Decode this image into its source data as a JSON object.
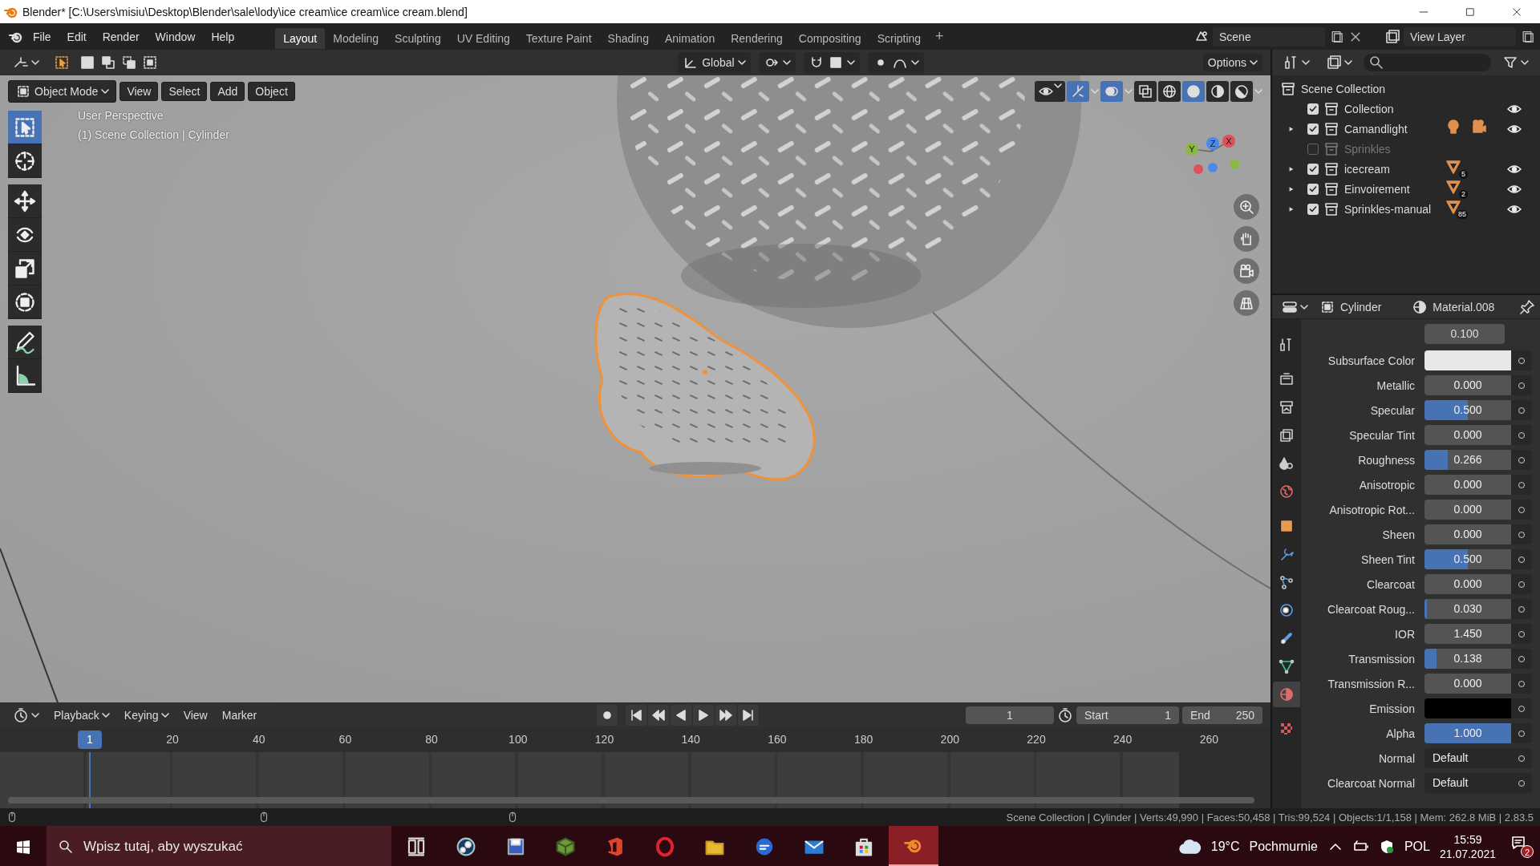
{
  "window": {
    "title": "Blender* [C:\\Users\\misiu\\Desktop\\Blender\\sale\\lody\\ice cream\\ice cream\\ice cream.blend]"
  },
  "menu": [
    "File",
    "Edit",
    "Render",
    "Window",
    "Help"
  ],
  "workspaces": [
    {
      "label": "Layout",
      "selected": true
    },
    {
      "label": "Modeling",
      "selected": false
    },
    {
      "label": "Sculpting",
      "selected": false
    },
    {
      "label": "UV Editing",
      "selected": false
    },
    {
      "label": "Texture Paint",
      "selected": false
    },
    {
      "label": "Shading",
      "selected": false
    },
    {
      "label": "Animation",
      "selected": false
    },
    {
      "label": "Rendering",
      "selected": false
    },
    {
      "label": "Compositing",
      "selected": false
    },
    {
      "label": "Scripting",
      "selected": false
    }
  ],
  "add_workspace": "+",
  "scene": "Scene",
  "view_layer": "View Layer",
  "viewport": {
    "orientation": "Global",
    "options": "Options",
    "mode": "Object Mode",
    "menus": [
      "View",
      "Select",
      "Add",
      "Object"
    ],
    "overlay_lines": [
      "User Perspective",
      "(1) Scene Collection | Cylinder"
    ],
    "gizmo_axes": [
      "Y",
      "Z",
      "X"
    ],
    "tools": [
      {
        "kind": "select",
        "selected": true
      },
      {
        "kind": "cursor",
        "selected": false
      },
      {
        "kind": "move",
        "selected": false
      },
      {
        "kind": "rotate",
        "selected": false
      },
      {
        "kind": "scale",
        "selected": false
      },
      {
        "kind": "transform",
        "selected": false
      },
      {
        "kind": "annotate",
        "selected": false
      },
      {
        "kind": "measure",
        "selected": false
      }
    ]
  },
  "outliner": {
    "root": "Scene Collection",
    "items": [
      {
        "label": "Collection",
        "expander": false,
        "checked": true,
        "disabled": false,
        "eye": true
      },
      {
        "label": "Camandlight",
        "expander": true,
        "checked": true,
        "disabled": false,
        "eye": true,
        "badges": [
          {
            "kind": "light"
          },
          {
            "kind": "camera"
          }
        ]
      },
      {
        "label": "Sprinkles",
        "expander": false,
        "checked": false,
        "disabled": true,
        "eye": false
      },
      {
        "label": "icecream",
        "expander": true,
        "checked": true,
        "disabled": false,
        "eye": true,
        "badges": [
          {
            "kind": "mesh",
            "count": "5"
          }
        ]
      },
      {
        "label": "Einvoirement",
        "expander": true,
        "checked": true,
        "disabled": false,
        "eye": true,
        "badges": [
          {
            "kind": "mesh",
            "count": "2"
          }
        ]
      },
      {
        "label": "Sprinkles-manual",
        "expander": true,
        "checked": true,
        "disabled": false,
        "eye": true,
        "badges": [
          {
            "kind": "mesh",
            "count": "85"
          }
        ]
      }
    ]
  },
  "properties": {
    "object": "Cylinder",
    "material": "Material.008",
    "top_value": "0.100",
    "tabs": [
      {
        "kind": "tool",
        "selected": false
      },
      {
        "kind": "render",
        "selected": false
      },
      {
        "kind": "output",
        "selected": false
      },
      {
        "kind": "viewlayer",
        "selected": false
      },
      {
        "kind": "scene",
        "selected": false
      },
      {
        "kind": "world",
        "selected": false
      },
      {
        "kind": "object",
        "selected": false
      },
      {
        "kind": "modifier",
        "selected": false
      },
      {
        "kind": "particles",
        "selected": false
      },
      {
        "kind": "physics",
        "selected": false
      },
      {
        "kind": "constraint",
        "selected": false
      },
      {
        "kind": "data",
        "selected": false
      },
      {
        "kind": "material",
        "selected": true
      },
      {
        "kind": "texture",
        "selected": false
      }
    ],
    "rows": [
      {
        "label": "Subsurface Color",
        "kind": "color",
        "color": "#e8e8e8"
      },
      {
        "label": "Metallic",
        "kind": "slider",
        "value": "0.000",
        "level": 0
      },
      {
        "label": "Specular",
        "kind": "slider",
        "value": "0.500",
        "level": 0.5
      },
      {
        "label": "Specular Tint",
        "kind": "slider",
        "value": "0.000",
        "level": 0
      },
      {
        "label": "Roughness",
        "kind": "slider",
        "value": "0.266",
        "level": 0.266
      },
      {
        "label": "Anisotropic",
        "kind": "slider",
        "value": "0.000",
        "level": 0
      },
      {
        "label": "Anisotropic Rot...",
        "kind": "slider",
        "value": "0.000",
        "level": 0
      },
      {
        "label": "Sheen",
        "kind": "slider",
        "value": "0.000",
        "level": 0
      },
      {
        "label": "Sheen Tint",
        "kind": "slider",
        "value": "0.500",
        "level": 0.5
      },
      {
        "label": "Clearcoat",
        "kind": "slider",
        "value": "0.000",
        "level": 0
      },
      {
        "label": "Clearcoat Roug...",
        "kind": "slider",
        "value": "0.030",
        "level": 0.03
      },
      {
        "label": "IOR",
        "kind": "number",
        "value": "1.450"
      },
      {
        "label": "Transmission",
        "kind": "slider",
        "value": "0.138",
        "level": 0.138
      },
      {
        "label": "Transmission R...",
        "kind": "slider",
        "value": "0.000",
        "level": 0
      },
      {
        "label": "Emission",
        "kind": "color",
        "color": "#000000"
      },
      {
        "label": "Alpha",
        "kind": "slider",
        "value": "1.000",
        "level": 1
      },
      {
        "label": "Normal",
        "kind": "menu",
        "value": "Default"
      },
      {
        "label": "Clearcoat Normal",
        "kind": "menu",
        "value": "Default"
      }
    ]
  },
  "timeline": {
    "menus": [
      "Playback",
      "Keying",
      "View",
      "Marker"
    ],
    "current_frame": "1",
    "start_label": "Start",
    "start": "1",
    "end_label": "End",
    "end": "250",
    "marker": "1",
    "ticks": [
      "20",
      "40",
      "60",
      "80",
      "100",
      "120",
      "140",
      "160",
      "180",
      "200",
      "220",
      "240",
      "260"
    ]
  },
  "status_bar": {
    "text": "Scene Collection | Cylinder | Verts:49,990 | Faces:50,458 | Tris:99,524 | Objects:1/1,158 | Mem: 262.8 MiB | 2.83.5"
  },
  "taskbar": {
    "search_placeholder": "Wpisz tutaj, aby wyszukać",
    "apps": [
      {
        "kind": "taskview",
        "selected": false
      },
      {
        "kind": "steam",
        "selected": false
      },
      {
        "kind": "save",
        "selected": false
      },
      {
        "kind": "block",
        "selected": false
      },
      {
        "kind": "office",
        "selected": false
      },
      {
        "kind": "opera",
        "selected": false
      },
      {
        "kind": "folder",
        "selected": false
      },
      {
        "kind": "chat",
        "selected": false
      },
      {
        "kind": "mail",
        "selected": false
      },
      {
        "kind": "store",
        "selected": false
      },
      {
        "kind": "blender",
        "selected": true
      }
    ],
    "temperature": "19°C",
    "weather": "Pochmurnie",
    "language": "POL",
    "time": "15:59",
    "date": "21.07.2021",
    "notifications": "2"
  }
}
